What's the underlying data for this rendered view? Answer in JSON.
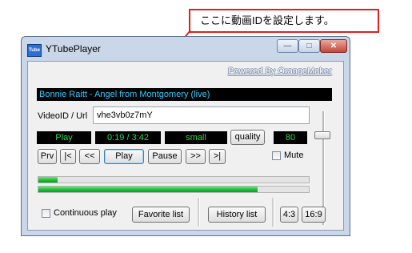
{
  "annotation": {
    "text": "ここに動画IDを設定します。"
  },
  "window": {
    "title": "YTubePlayer",
    "icon_text": "Tube"
  },
  "powered_by": "Powered By OrangeMaker",
  "now_playing": "Bonnie Raitt - Angel from Montgomery (live)",
  "video": {
    "label": "VideoID / Url",
    "value": "vhe3vb0z7mY"
  },
  "status": {
    "state": "Play",
    "time": "0:19 / 3:42",
    "size": "small",
    "volume": "80"
  },
  "buttons": {
    "quality": "quality",
    "prv": "Prv",
    "first": "|<",
    "back": "<<",
    "play": "Play",
    "pause": "Pause",
    "forward": ">>",
    "last": ">|",
    "favorite": "Favorite list",
    "history": "History list",
    "ratio_43": "4:3",
    "ratio_169": "16:9"
  },
  "mute": {
    "label": "Mute",
    "checked": false
  },
  "continuous": {
    "label": "Continuous play",
    "checked": false
  },
  "progress": {
    "buffer": 0.07,
    "playback": 0.81
  },
  "colors": {
    "callout_border": "#e0201c",
    "display_text": "#29d84a",
    "title_text": "#3ec8ff",
    "progress": "#19b831"
  }
}
